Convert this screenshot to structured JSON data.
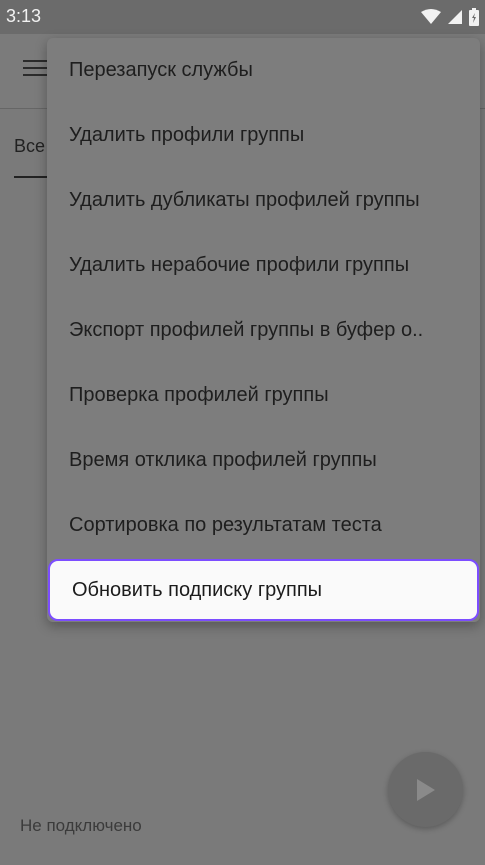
{
  "status_bar": {
    "time": "3:13"
  },
  "tabs": {
    "current_label": "Все"
  },
  "menu": {
    "items": [
      "Перезапуск службы",
      "Удалить профили группы",
      "Удалить дубликаты профилей группы",
      "Удалить нерабочие профили группы",
      "Экспорт профилей группы в буфер о..",
      "Проверка профилей группы",
      "Время отклика профилей группы",
      "Сортировка по результатам теста",
      "Обновить подписку группы"
    ],
    "highlighted_index": 8,
    "accent_color": "#7c4dff"
  },
  "footer": {
    "connection_status": "Не подключено"
  },
  "fab": {
    "icon": "play-icon"
  }
}
